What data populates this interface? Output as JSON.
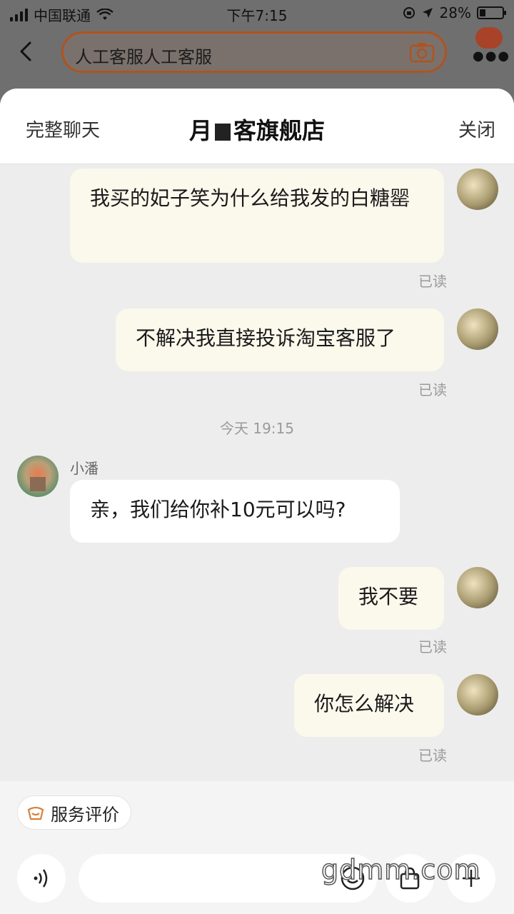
{
  "status_bar": {
    "carrier": "中国联通",
    "time": "下午7:15",
    "battery": "28%",
    "battery_level": 0.28
  },
  "search": {
    "query": "人工客服人工客服"
  },
  "sheet_header": {
    "left_action": "完整聊天",
    "store_name_prefix": "月",
    "store_name_suffix": "客旗舰店",
    "right_action": "关闭"
  },
  "messages": [
    {
      "side": "right",
      "text": "我买的妃子笑为什么给我发的白糖罂",
      "status": "已读"
    },
    {
      "side": "right",
      "text": "不解决我直接投诉淘宝客服了",
      "status": "已读"
    },
    {
      "side": "left",
      "sender": "小潘",
      "text": "亲，我们给你补10元可以吗?"
    },
    {
      "side": "right",
      "text": "我不要",
      "status": "已读"
    },
    {
      "side": "right",
      "text": "你怎么解决",
      "status": "已读"
    }
  ],
  "timestamp": "今天 19:15",
  "bottom": {
    "service_rating_label": "服务评价"
  },
  "watermark": "gdmm.com",
  "colors": {
    "accent": "#b0531f",
    "bubble_self": "#fbf8ec",
    "bubble_other": "#ffffff",
    "background": "#ededed"
  }
}
